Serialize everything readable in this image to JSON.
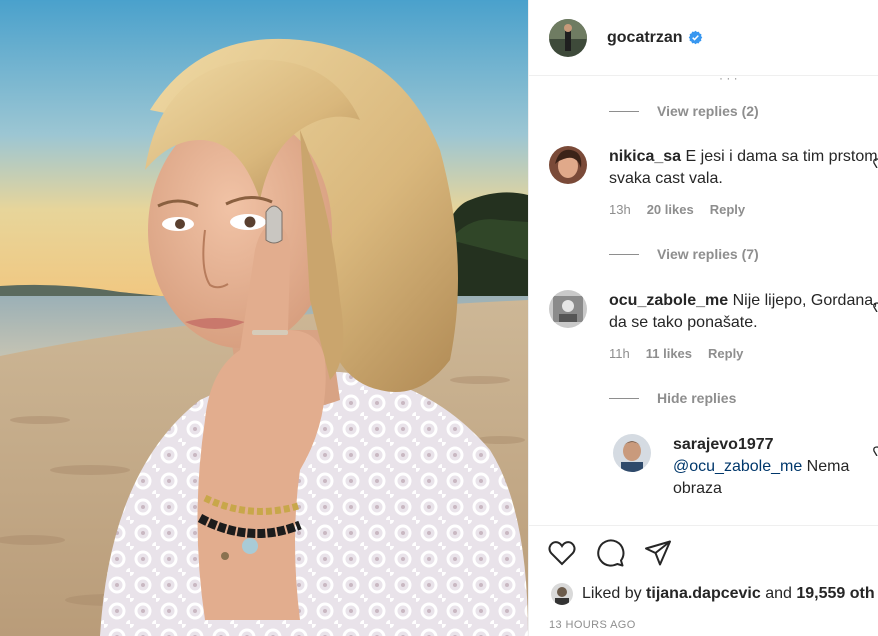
{
  "post": {
    "username": "gocatrzan",
    "verified_icon": "verified-badge-icon",
    "photo_description_icon": "post-photo"
  },
  "comments_panel": {
    "items": [
      {
        "kind": "view-replies",
        "label": "View replies (2)"
      },
      {
        "kind": "comment",
        "username": "nikica_sa",
        "text": "E jesi i dama sa tim prstom svaka cast vala.",
        "time": "13h",
        "likes": "20 likes",
        "reply": "Reply"
      },
      {
        "kind": "view-replies",
        "label": "View replies (7)"
      },
      {
        "kind": "comment",
        "username": "ocu_zabole_me",
        "text": "Nije lijepo, Gordana, da se tako ponašate.",
        "time": "11h",
        "likes": "11 likes",
        "reply": "Reply"
      },
      {
        "kind": "view-replies",
        "label": "Hide replies"
      },
      {
        "kind": "reply",
        "username": "sarajevo1977",
        "mention": "@ocu_zabole_me",
        "text": "Nema obraza"
      }
    ]
  },
  "actions": {
    "like_icon": "heart-icon",
    "comment_icon": "comment-bubble-icon",
    "share_icon": "paper-plane-icon"
  },
  "likes": {
    "prefix": "Liked by",
    "user": "tijana.dapcevic",
    "and": "and",
    "others": "19,559 oth"
  },
  "timestamp": "13 HOURS AGO",
  "colors": {
    "verified": "#3897f0",
    "muted": "#8e8e8e",
    "mention": "#00376b",
    "border": "#efefef"
  }
}
